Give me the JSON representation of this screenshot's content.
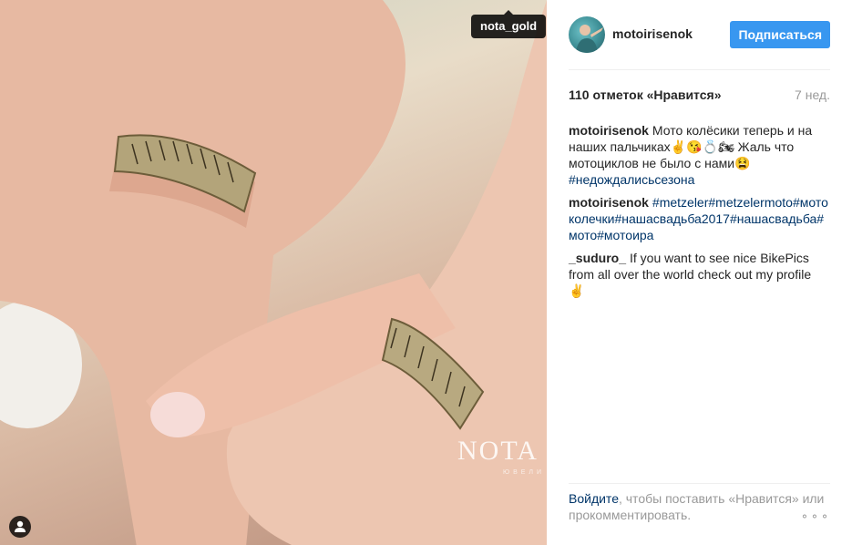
{
  "photo": {
    "tag_label": "nota_gold",
    "watermark": "NOTA",
    "watermark_sub": "ЮВЕЛИ"
  },
  "header": {
    "username": "motoirisenok",
    "follow_label": "Подписаться"
  },
  "post": {
    "likes": "110 отметок «Нравится»",
    "time": "7 нед."
  },
  "comments": [
    {
      "author": "motoirisenok",
      "text": "Мото колёсики теперь и на наших пальчиках✌️😘💍🏍 Жаль что мотоциклов не было с нами😫",
      "hashtags": "#недождалисьсезона"
    },
    {
      "author": "motoirisenok",
      "text": "",
      "hashtags": "#metzeler#metzelermoto#мотоколечки#нашасвадьба2017#нашасвадьба#мото#мотоира"
    },
    {
      "author": "_suduro_",
      "text": "If you want to see nice BikePics from all over the world check out my profile ✌️",
      "hashtags": ""
    }
  ],
  "footer": {
    "login_link": "Войдите",
    "login_text": ", чтобы поставить «Нравится» или прокомментировать.",
    "more_icon": "⚬⚬⚬"
  },
  "colors": {
    "accent": "#3897f0",
    "hashtag": "#003569",
    "muted": "#999999"
  },
  "icons": [
    "user-tag-icon",
    "more-options-icon"
  ]
}
